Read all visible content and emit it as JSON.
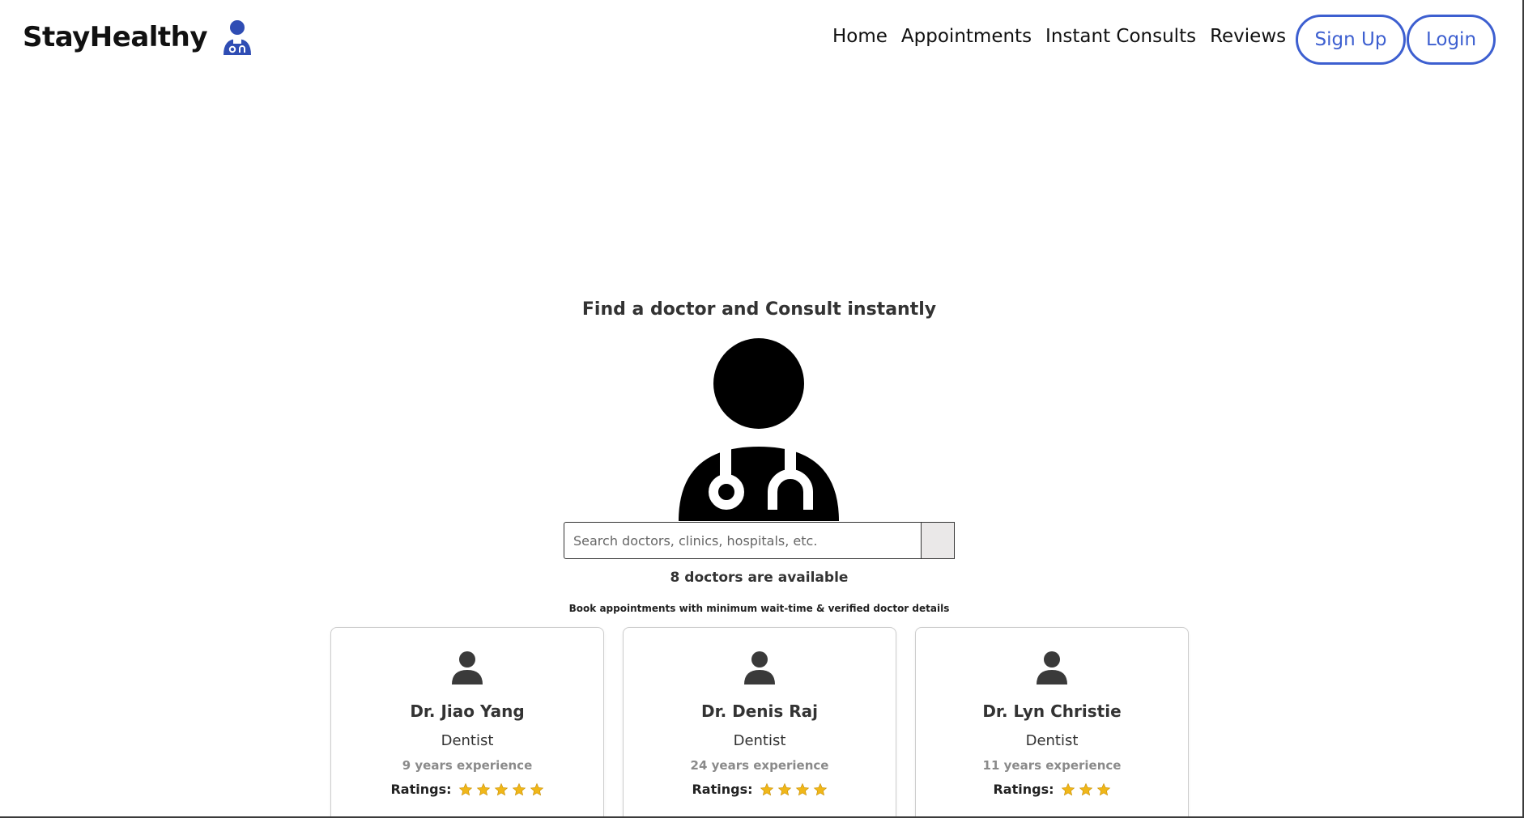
{
  "brand": {
    "title": "StayHealthy",
    "logo_icon": "doctor-icon",
    "logo_color": "#2f4db4"
  },
  "nav": {
    "links": [
      "Home",
      "Appointments",
      "Instant Consults",
      "Reviews"
    ],
    "signup_label": "Sign Up",
    "login_label": "Login",
    "accent_color": "#3d5fd0"
  },
  "hero": {
    "heading": "Find a doctor and Consult instantly",
    "illustration_icon": "doctor-with-stethoscope-icon"
  },
  "search": {
    "placeholder": "Search doctors, clinics, hospitals, etc.",
    "value": "",
    "button_icon": "search-button"
  },
  "results": {
    "available_text": "8 doctors are available",
    "sub_text": "Book appointments with minimum wait-time & verified doctor details"
  },
  "doctors": [
    {
      "name": "Dr. Jiao Yang",
      "specialty": "Dentist",
      "experience": "9 years experience",
      "ratings_label": "Ratings:",
      "stars": 5
    },
    {
      "name": "Dr. Denis Raj",
      "specialty": "Dentist",
      "experience": "24 years experience",
      "ratings_label": "Ratings:",
      "stars": 4
    },
    {
      "name": "Dr. Lyn Christie",
      "specialty": "Dentist",
      "experience": "11 years experience",
      "ratings_label": "Ratings:",
      "stars": 3
    }
  ],
  "colors": {
    "star": "#f0b719",
    "avatar": "#3a3a3a"
  }
}
